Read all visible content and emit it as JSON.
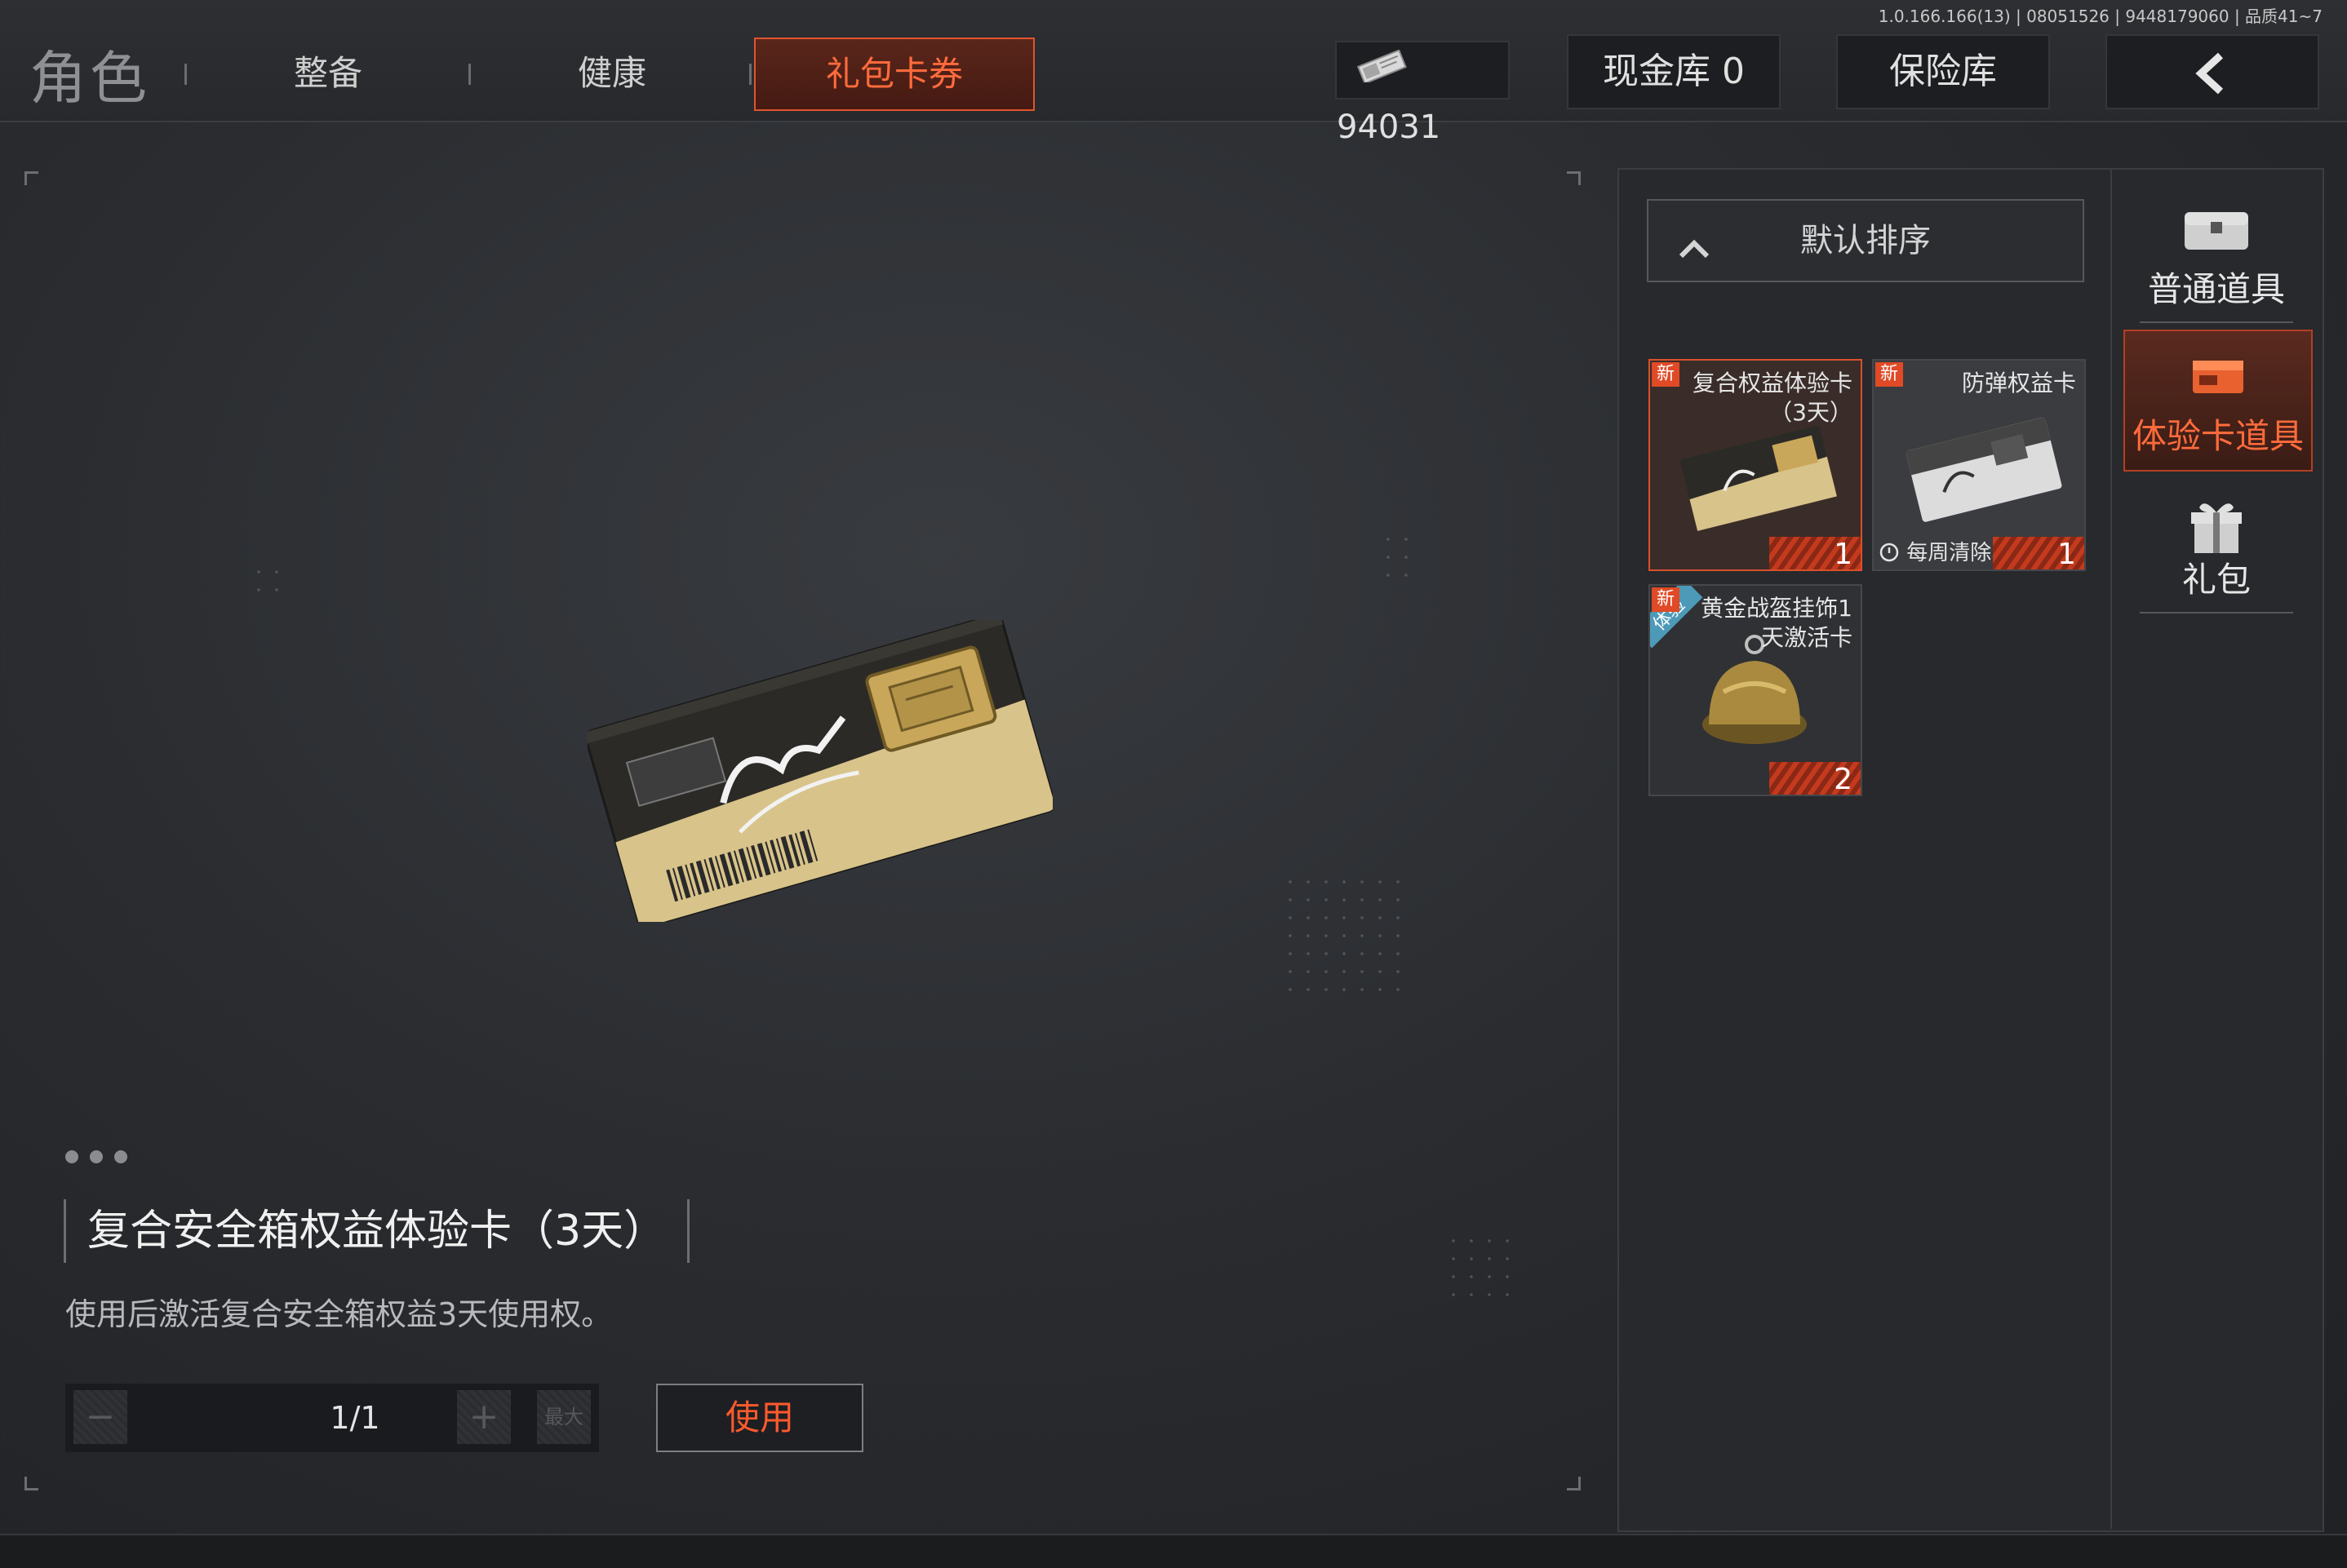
{
  "version": "1.0.166.166(13) | 08051526 | 9448179060 | 品质41~7",
  "header": {
    "title": "角色",
    "tabs": [
      {
        "label": "整备",
        "active": false
      },
      {
        "label": "健康",
        "active": false
      },
      {
        "label": "礼包卡券",
        "active": true
      }
    ],
    "currency_value": "94031",
    "cash_vault": "现金库 0",
    "safe_vault": "保险库"
  },
  "icons": {
    "currency": "ticket-icon",
    "back": "chevron-left-icon",
    "sort": "chevron-up-icon",
    "common": "chest-icon",
    "trial": "card-box-icon",
    "gift": "gift-icon"
  },
  "colors": {
    "accent": "#ff5a2c",
    "accent_border": "#d9512c",
    "new_badge": "#e04a26",
    "trial_tag": "#4d9ab8"
  },
  "detail": {
    "name": "复合安全箱权益体验卡（3天）",
    "description": "使用后激活复合安全箱权益3天使用权。",
    "quantity": "1/1",
    "minus_label": "−",
    "plus_label": "+",
    "max_label": "最大",
    "use_label": "使用"
  },
  "sort": {
    "label": "默认排序"
  },
  "categories": [
    {
      "label": "普通道具",
      "active": false
    },
    {
      "label": "体验卡道具",
      "active": true
    },
    {
      "label": "礼包",
      "active": false
    }
  ],
  "items": [
    {
      "new": "新",
      "name_line1": "复合权益体验卡",
      "name_line2": "（3天）",
      "count": "1",
      "selected": true
    },
    {
      "new": "新",
      "name_line1": "防弹权益卡",
      "weekly": "每周清除",
      "count": "1",
      "selected": false
    },
    {
      "new": "新",
      "trial_tag": "体验",
      "name_line1": "黄金战盔挂饰1",
      "name_line2": "天激活卡",
      "count": "2",
      "selected": false
    }
  ]
}
